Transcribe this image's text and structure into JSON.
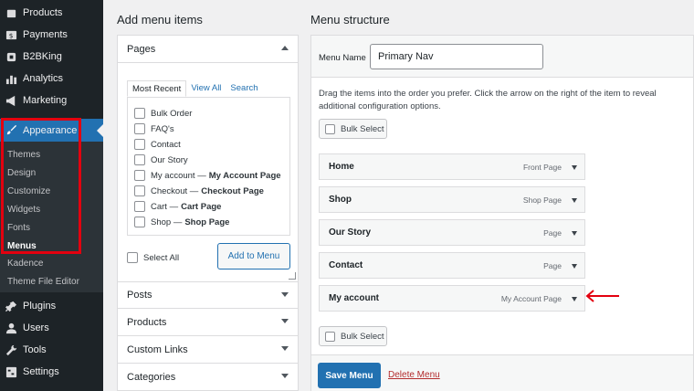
{
  "sidebar": {
    "items": [
      {
        "label": "Products",
        "icon": "products-icon"
      },
      {
        "label": "Payments",
        "icon": "payments-icon"
      },
      {
        "label": "B2BKing",
        "icon": "b2bking-icon"
      },
      {
        "label": "Analytics",
        "icon": "analytics-icon"
      },
      {
        "label": "Marketing",
        "icon": "marketing-icon"
      },
      {
        "label": "Appearance",
        "icon": "paintbrush-icon",
        "active": true
      },
      {
        "label": "Plugins",
        "icon": "plugins-icon"
      },
      {
        "label": "Users",
        "icon": "users-icon"
      },
      {
        "label": "Tools",
        "icon": "tools-icon"
      },
      {
        "label": "Settings",
        "icon": "settings-icon"
      }
    ],
    "submenu": [
      "Themes",
      "Design",
      "Customize",
      "Widgets",
      "Fonts",
      "Menus",
      "Kadence",
      "Theme File Editor"
    ],
    "current_submenu": "Menus",
    "active_color": "#2271b1",
    "highlight_color": "#e3000f"
  },
  "add_items": {
    "heading": "Add menu items",
    "pages_title": "Pages",
    "tabs": [
      "Most Recent",
      "View All",
      "Search"
    ],
    "pages": [
      {
        "name": "Bulk Order",
        "suffix": ""
      },
      {
        "name": "FAQ's",
        "suffix": ""
      },
      {
        "name": "Contact",
        "suffix": ""
      },
      {
        "name": "Our Story",
        "suffix": ""
      },
      {
        "name": "My account —",
        "suffix": "My Account Page"
      },
      {
        "name": "Checkout —",
        "suffix": "Checkout Page"
      },
      {
        "name": "Cart —",
        "suffix": "Cart Page"
      },
      {
        "name": "Shop —",
        "suffix": "Shop Page"
      }
    ],
    "select_all": "Select All",
    "add_button": "Add to Menu",
    "sections": [
      "Posts",
      "Products",
      "Custom Links",
      "Categories"
    ]
  },
  "structure": {
    "heading": "Menu structure",
    "name_label": "Menu Name",
    "name_value": "Primary Nav",
    "instructions": "Drag the items into the order you prefer. Click the arrow on the right of the item to reveal additional configuration options.",
    "bulk_select": "Bulk Select",
    "items": [
      {
        "title": "Home",
        "type": "Front Page"
      },
      {
        "title": "Shop",
        "type": "Shop Page"
      },
      {
        "title": "Our Story",
        "type": "Page"
      },
      {
        "title": "Contact",
        "type": "Page"
      },
      {
        "title": "My account",
        "type": "My Account Page"
      }
    ],
    "save_button": "Save Menu",
    "delete_link": "Delete Menu",
    "annotation_arrow_color": "#e3000f"
  }
}
